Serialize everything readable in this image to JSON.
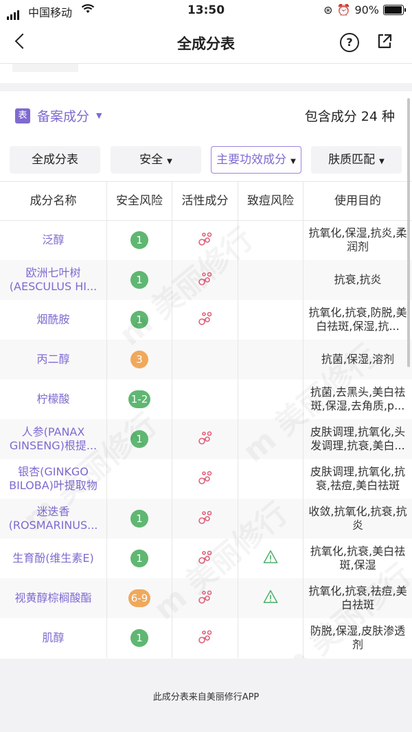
{
  "status_bar": {
    "carrier": "中国移动",
    "time": "13:50",
    "battery": "90%"
  },
  "nav": {
    "title": "全成分表"
  },
  "summary": {
    "tag": "表",
    "section_label": "备案成分",
    "count_text": "包含成分 24 种"
  },
  "filters": [
    {
      "label": "全成分表"
    },
    {
      "label": "安全"
    },
    {
      "label": "主要功效成分"
    },
    {
      "label": "肤质匹配"
    }
  ],
  "table": {
    "headers": [
      "成分名称",
      "安全风险",
      "活性成分",
      "致痘风险",
      "使用目的"
    ],
    "rows": [
      {
        "name": "泛醇",
        "safety": "1",
        "level": "green",
        "active": true,
        "acne": false,
        "purpose": "抗氧化,保湿,抗炎,柔润剂"
      },
      {
        "name": "欧洲七叶树(AESCULUS HI...",
        "safety": "1",
        "level": "green",
        "active": true,
        "acne": false,
        "purpose": "抗衰,抗炎"
      },
      {
        "name": "烟酰胺",
        "safety": "1",
        "level": "green",
        "active": true,
        "acne": false,
        "purpose": "抗氧化,抗衰,防脱,美白祛斑,保湿,抗..."
      },
      {
        "name": "丙二醇",
        "safety": "3",
        "level": "orange",
        "active": false,
        "acne": false,
        "purpose": "抗菌,保湿,溶剂"
      },
      {
        "name": "柠檬酸",
        "safety": "1-2",
        "level": "green",
        "active": false,
        "acne": false,
        "purpose": "抗菌,去黑头,美白祛斑,保湿,去角质,p..."
      },
      {
        "name": "人参(PANAX GINSENG)根提...",
        "safety": "1",
        "level": "green",
        "active": true,
        "acne": false,
        "purpose": "皮肤调理,抗氧化,头发调理,抗衰,美白..."
      },
      {
        "name": "银杏(GINKGO BILOBA)叶提取物",
        "safety": "",
        "level": "",
        "active": true,
        "acne": false,
        "purpose": "皮肤调理,抗氧化,抗衰,祛痘,美白祛斑"
      },
      {
        "name": "迷迭香(ROSMARINUS...",
        "safety": "1",
        "level": "green",
        "active": true,
        "acne": false,
        "purpose": "收敛,抗氧化,抗衰,抗炎"
      },
      {
        "name": "生育酚(维生素E)",
        "safety": "1",
        "level": "green",
        "active": true,
        "acne": true,
        "purpose": "抗氧化,抗衰,美白祛斑,保湿"
      },
      {
        "name": "视黄醇棕榈酸酯",
        "safety": "6-9",
        "level": "orange",
        "active": true,
        "acne": true,
        "purpose": "抗氧化,抗衰,祛痘,美白祛斑"
      },
      {
        "name": "肌醇",
        "safety": "1",
        "level": "green",
        "active": true,
        "acne": false,
        "purpose": "防脱,保湿,皮肤渗透剂"
      }
    ]
  },
  "footer": {
    "text": "此成分表来自美丽修行APP"
  },
  "watermark": {
    "text": "m 美丽修行"
  },
  "colors": {
    "accent": "#7f6ad0",
    "safe_green": "#5fb772",
    "risk_orange": "#f0a85c",
    "active_red": "#e0607a",
    "acne_green": "#4caf6a"
  }
}
